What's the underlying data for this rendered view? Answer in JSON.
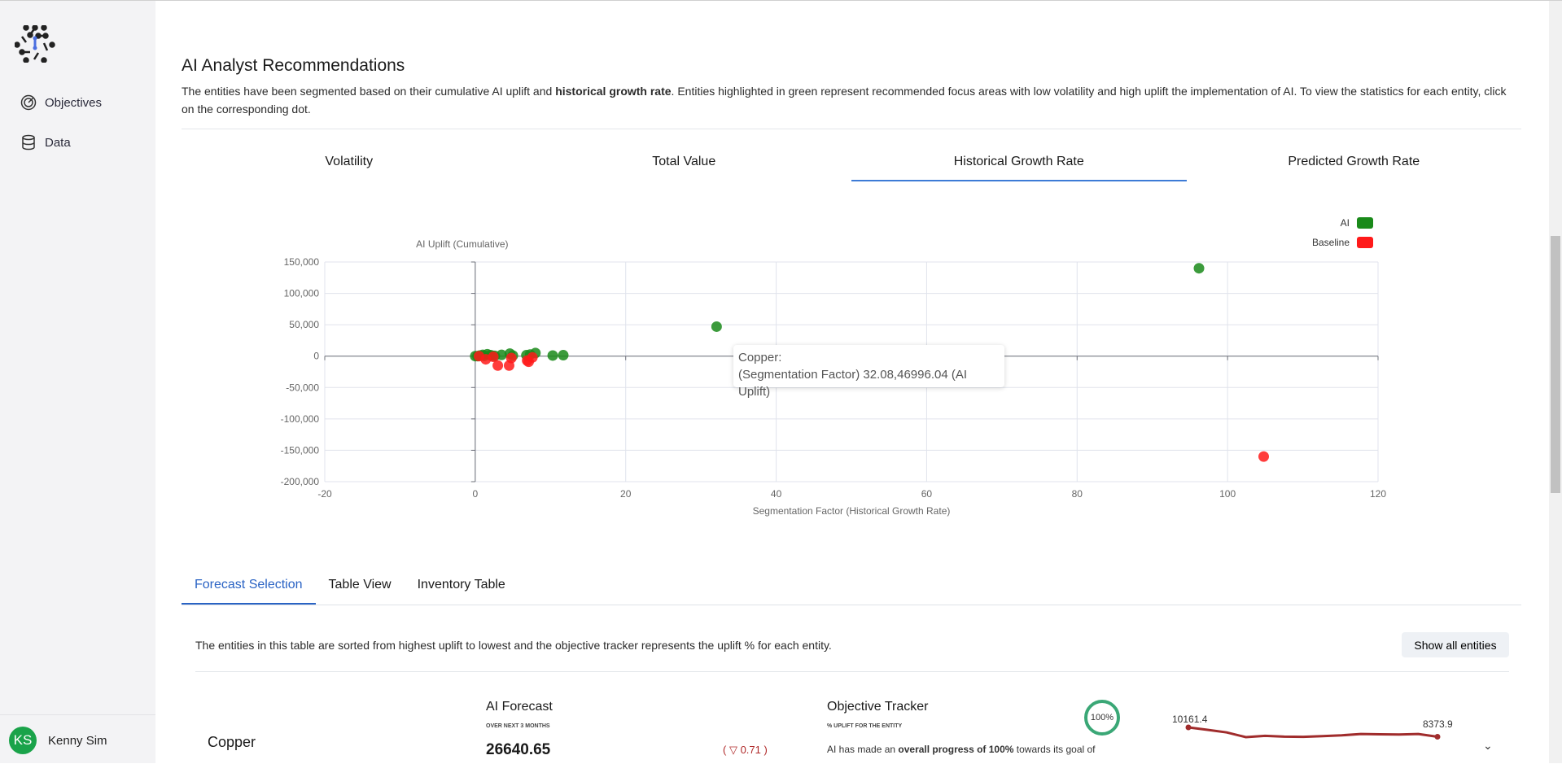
{
  "sidebar": {
    "nav": [
      {
        "label": "Objectives",
        "icon": "target-icon"
      },
      {
        "label": "Data",
        "icon": "database-icon"
      }
    ],
    "user": {
      "initials": "KS",
      "name": "Kenny Sim",
      "avatar_color": "#1aa34a"
    }
  },
  "header": {
    "title": "AI Analyst Recommendations",
    "desc_pre": "The entities have been segmented based on their cumulative AI uplift and ",
    "desc_bold": "historical growth rate",
    "desc_post": ". Entities highlighted in green represent recommended focus areas with low volatility and high uplift the implementation of AI. To view the statistics for each entity, click on the corresponding dot."
  },
  "chart_tabs": [
    {
      "label": "Volatility"
    },
    {
      "label": "Total Value"
    },
    {
      "label": "Historical Growth Rate",
      "active": true
    },
    {
      "label": "Predicted Growth Rate"
    }
  ],
  "chart_data": {
    "type": "scatter",
    "xlabel": "Segmentation Factor (Historical Growth Rate)",
    "ylabel": "AI Uplift (Cumulative)",
    "xlim": [
      -20,
      120
    ],
    "ylim": [
      -200000,
      150000
    ],
    "xticks": [
      -20,
      0,
      20,
      40,
      60,
      80,
      100,
      120
    ],
    "yticks": [
      "150,000",
      "100,000",
      "50,000",
      "0",
      "-50,000",
      "-100,000",
      "-150,000",
      "-200,000"
    ],
    "ytick_values": [
      150000,
      100000,
      50000,
      0,
      -50000,
      -100000,
      -150000,
      -200000
    ],
    "grid": true,
    "legend": "top-right",
    "series": [
      {
        "name": "AI",
        "color": "#1a8a1a",
        "points": [
          [
            96.2,
            140000
          ],
          [
            32.08,
            46996.04
          ],
          [
            0,
            0
          ],
          [
            0.3,
            0
          ],
          [
            0.6,
            1000
          ],
          [
            1,
            2000
          ],
          [
            1.2,
            500
          ],
          [
            1.6,
            3000
          ],
          [
            2,
            1500
          ],
          [
            2.2,
            1000
          ],
          [
            2.6,
            500
          ],
          [
            3.5,
            2000
          ],
          [
            4.6,
            4000
          ],
          [
            5,
            1000
          ],
          [
            6.8,
            1500
          ],
          [
            7.3,
            2500
          ],
          [
            8,
            5000
          ],
          [
            10.3,
            1000
          ],
          [
            11.7,
            1500
          ]
        ]
      },
      {
        "name": "Baseline",
        "color": "#ff1a1a",
        "points": [
          [
            104.8,
            -160000
          ],
          [
            0.5,
            0
          ],
          [
            1.4,
            -5000
          ],
          [
            2.4,
            -1000
          ],
          [
            3,
            -15000
          ],
          [
            4.5,
            -15000
          ],
          [
            4.8,
            -3000
          ],
          [
            6.9,
            -7000
          ],
          [
            7.1,
            -9000
          ],
          [
            7.6,
            -2000
          ]
        ]
      }
    ],
    "tooltip": {
      "title": "Copper:",
      "body": "(Segmentation Factor) 32.08,46996.04 (AI Uplift)"
    }
  },
  "bottom_tabs": [
    {
      "label": "Forecast Selection",
      "active": true
    },
    {
      "label": "Table View"
    },
    {
      "label": "Inventory Table"
    }
  ],
  "table_note": "The entities in this table are sorted from highest uplift to lowest and the objective tracker represents the uplift % for each entity.",
  "show_all_label": "Show all entities",
  "entity": {
    "name": "Copper",
    "forecast_title": "AI Forecast",
    "forecast_sub": "OVER NEXT 3 MONTHS",
    "forecast_value": "26640.65",
    "change": "0.71",
    "change_dir": "down",
    "tracker_title": "Objective Tracker",
    "tracker_sub": "% UPLIFT FOR THE ENTITY",
    "progress": "100%",
    "progress_value": 100,
    "tracker_pre": "AI has made an ",
    "tracker_bold": "overall progress of 100%",
    "tracker_post": " towards its goal of",
    "spark_start": "10161.4",
    "spark_end": "8373.9",
    "spark": [
      10161.4,
      9700,
      9200,
      8300,
      8550,
      8400,
      8350,
      8500,
      8650,
      8900,
      8850,
      8800,
      8900,
      8373.9
    ]
  }
}
